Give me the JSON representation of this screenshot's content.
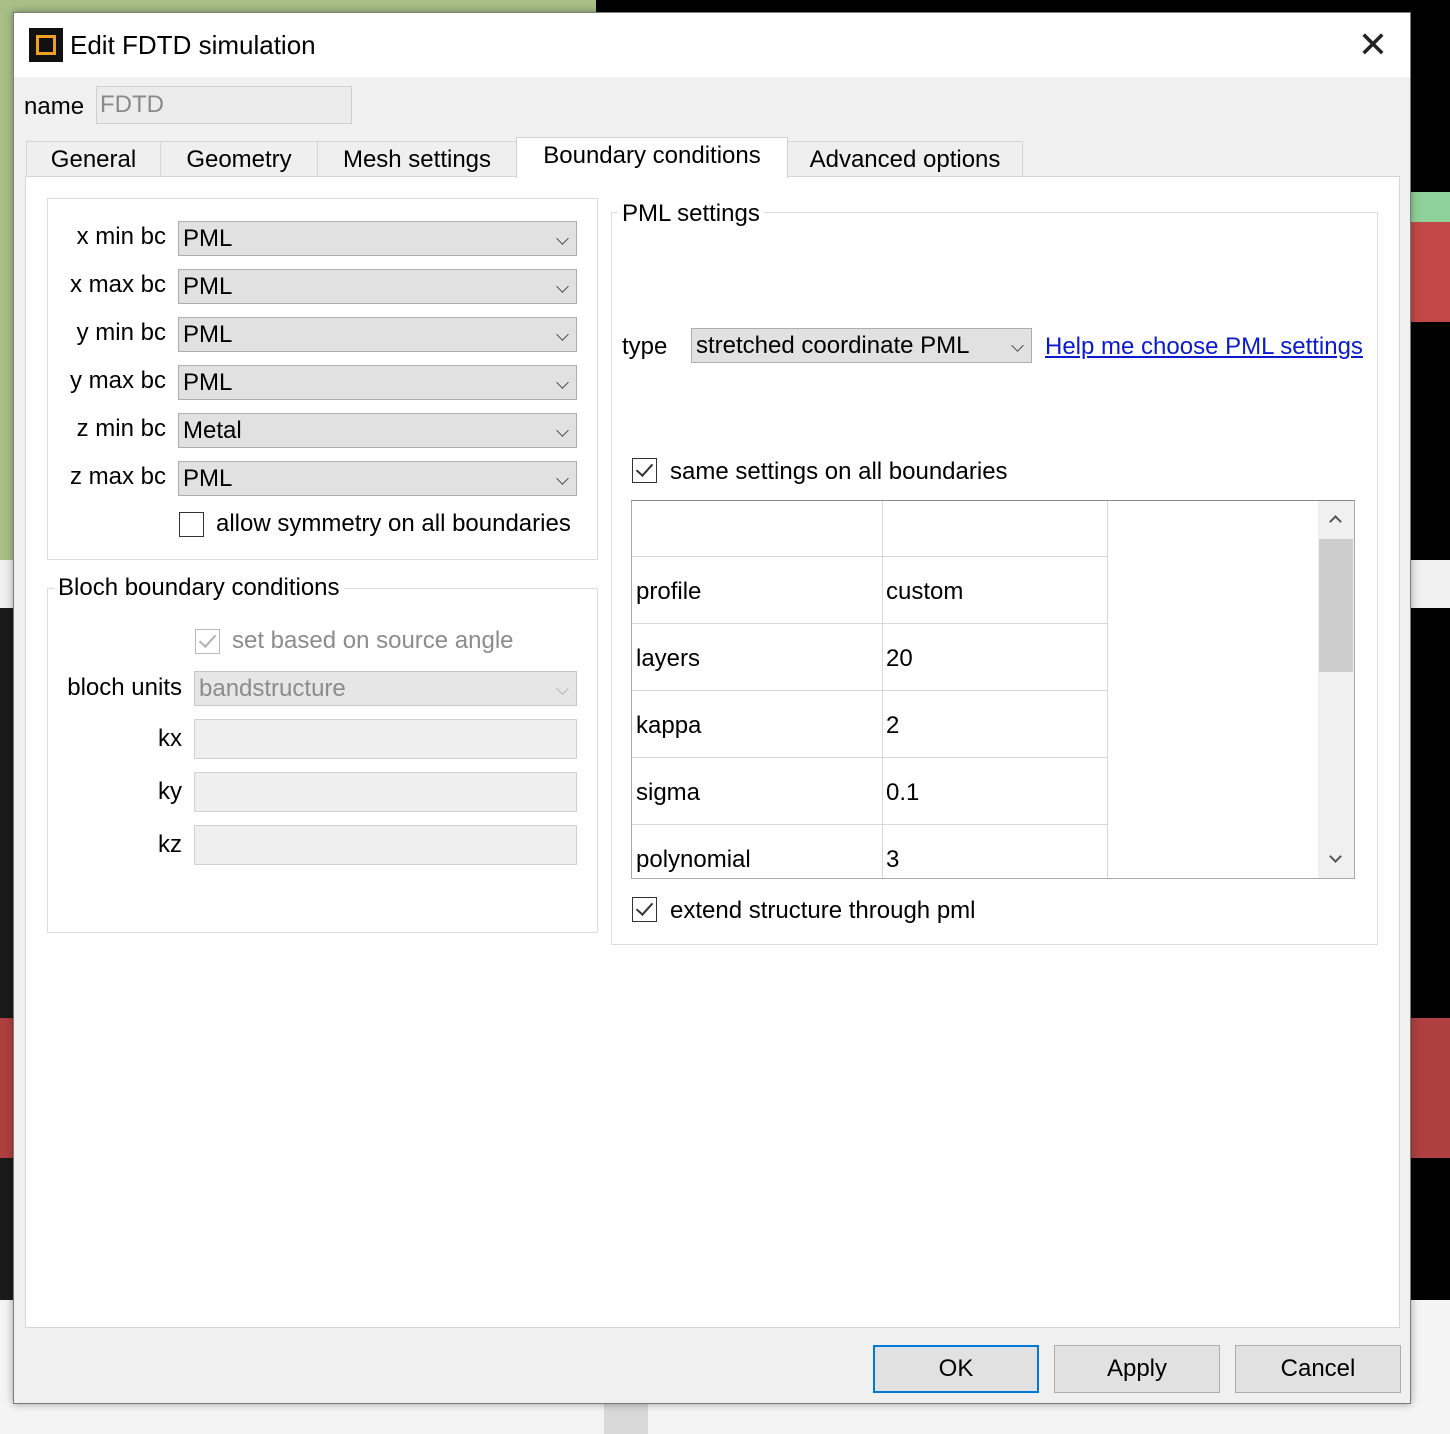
{
  "window": {
    "title": "Edit FDTD simulation",
    "close_glyph": "✕",
    "app_icon": "fdtd-app-icon"
  },
  "name_field": {
    "label": "name",
    "value": "FDTD"
  },
  "tabs": [
    {
      "label": "General",
      "active": false
    },
    {
      "label": "Geometry",
      "active": false
    },
    {
      "label": "Mesh settings",
      "active": false
    },
    {
      "label": "Boundary conditions",
      "active": true
    },
    {
      "label": "Advanced options",
      "active": false
    }
  ],
  "boundaries": {
    "rows": [
      {
        "label": "x min bc",
        "value": "PML"
      },
      {
        "label": "x max bc",
        "value": "PML"
      },
      {
        "label": "y min bc",
        "value": "PML"
      },
      {
        "label": "y max bc",
        "value": "PML"
      },
      {
        "label": "z min bc",
        "value": "Metal"
      },
      {
        "label": "z max bc",
        "value": "PML"
      }
    ],
    "allow_symmetry": {
      "label": "allow symmetry on all boundaries",
      "checked": false
    }
  },
  "bloch": {
    "title": "Bloch boundary conditions",
    "set_based": {
      "label": "set based on source angle",
      "checked": true
    },
    "units_label": "bloch units",
    "units_value": "bandstructure",
    "kx_label": "kx",
    "kx_value": "",
    "ky_label": "ky",
    "ky_value": "",
    "kz_label": "kz",
    "kz_value": ""
  },
  "pml": {
    "title": "PML settings",
    "type_label": "type",
    "type_value": "stretched coordinate PML",
    "help_link": "Help me choose PML settings",
    "same_settings": {
      "label": "same settings on all boundaries",
      "checked": true
    },
    "table": {
      "header": [
        "",
        ""
      ],
      "rows": [
        {
          "name": "profile",
          "value": "custom"
        },
        {
          "name": "layers",
          "value": "20"
        },
        {
          "name": "kappa",
          "value": "2"
        },
        {
          "name": "sigma",
          "value": "0.1"
        },
        {
          "name": "polynomial",
          "value": "3"
        }
      ]
    },
    "extend": {
      "label": "extend structure through pml",
      "checked": true
    }
  },
  "buttons": {
    "ok": "OK",
    "apply": "Apply",
    "cancel": "Cancel"
  }
}
